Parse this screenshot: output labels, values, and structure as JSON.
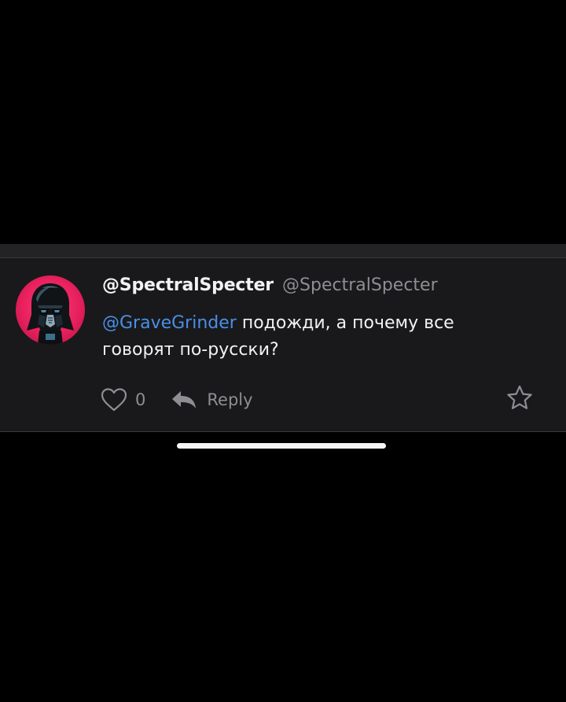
{
  "comment": {
    "display_name": "@SpectralSpecter",
    "handle": "@SpectralSpecter",
    "mention": "@GraveGrinder",
    "text": " подожди, а почему все говорят по-русски?",
    "like_count": "0",
    "reply_label": "Reply"
  },
  "icons": {
    "avatar": "darth-vader-avatar",
    "like": "heart-icon",
    "reply": "reply-arrow-icon",
    "favorite": "star-icon"
  },
  "colors": {
    "background": "#000000",
    "card": "#19191b",
    "mention": "#4a8fe8",
    "muted": "#8e8e93",
    "avatar_ring": "#e8205e"
  }
}
